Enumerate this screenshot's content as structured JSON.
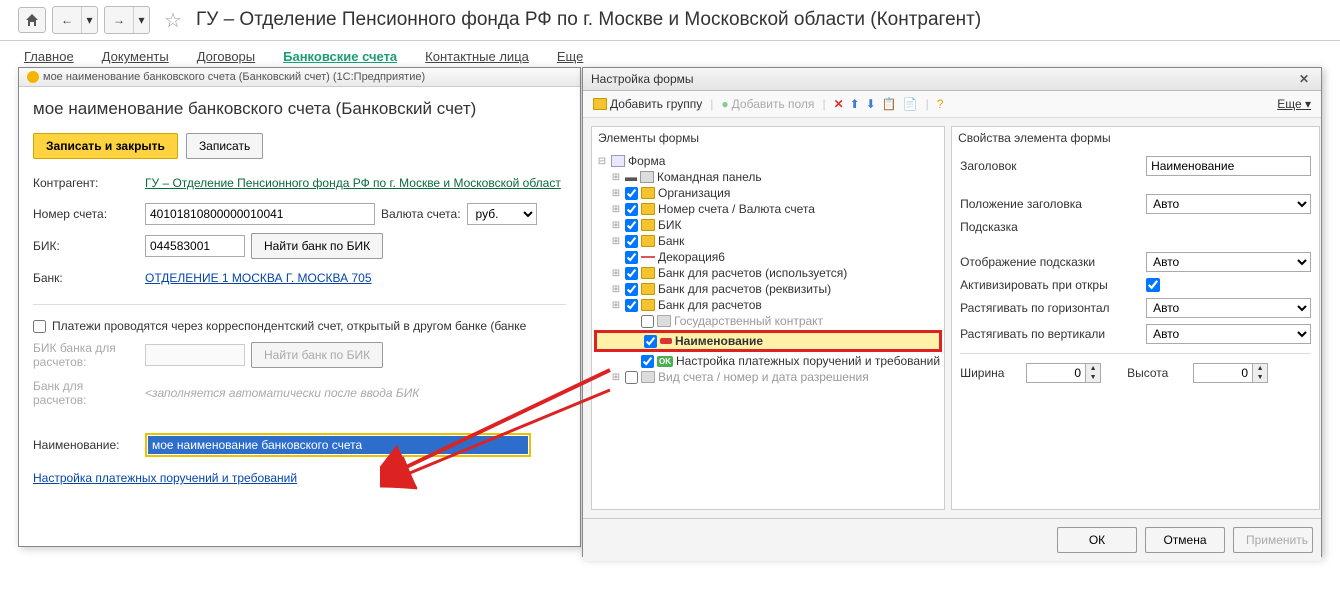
{
  "page_title": "ГУ – Отделение Пенсионного фонда РФ по г. Москве и Московской области (Контрагент)",
  "nav": {
    "tabs": [
      "Главное",
      "Документы",
      "Договоры",
      "Банковские счета",
      "Контактные лица",
      "Еще"
    ],
    "active_index": 3
  },
  "left_dialog": {
    "window_title": "мое наименование банковского счета (Банковский счет)   (1С:Предприятие)",
    "heading": "мое наименование банковского счета (Банковский счет)",
    "btn_save_close": "Записать и закрыть",
    "btn_save": "Записать",
    "counterparty_label": "Контрагент:",
    "counterparty_value": "ГУ – Отделение Пенсионного фонда РФ по г. Москве и Московской област",
    "account_label": "Номер счета:",
    "account_value": "40101810800000010041",
    "currency_label": "Валюта счета:",
    "currency_value": "руб.",
    "bik_label": "БИК:",
    "bik_value": "044583001",
    "find_bank_btn": "Найти банк по БИК",
    "bank_label": "Банк:",
    "bank_value": "ОТДЕЛЕНИЕ 1 МОСКВА Г. МОСКВА 705",
    "corr_checkbox_label": "Платежи проводятся через корреспондентский счет, открытый в другом банке (банке",
    "bik_corr_label": "БИК банка для расчетов:",
    "find_bank_btn2": "Найти банк по БИК",
    "bank_corr_label": "Банк для расчетов:",
    "bank_corr_placeholder": "<заполняется автоматически после ввода БИК",
    "name_label": "Наименование:",
    "name_value": "мое наименование банковского счета",
    "payment_settings_link": "Настройка платежных поручений и требований"
  },
  "right_dialog": {
    "title": "Настройка формы",
    "add_group": "Добавить группу",
    "add_fields": "Добавить поля",
    "more": "Еще",
    "left_panel_title": "Элементы формы",
    "right_panel_title": "Свойства элемента формы",
    "tree": {
      "root": "Форма",
      "items": [
        "Командная панель",
        "Организация",
        "Номер счета / Валюта счета",
        "БИК",
        "Банк",
        "Декорация6",
        "Банк для расчетов (используется)",
        "Банк для расчетов (реквизиты)",
        "Банк для расчетов",
        "Государственный контракт",
        "Наименование",
        "Настройка платежных поручений и требований",
        "Вид счета / номер и дата разрешения"
      ]
    },
    "props": {
      "title_label": "Заголовок",
      "title_value": "Наименование",
      "title_pos_label": "Положение заголовка",
      "title_pos_value": "Авто",
      "hint_label": "Подсказка",
      "hint_display_label": "Отображение подсказки",
      "hint_display_value": "Авто",
      "activate_label": "Активизировать при откры",
      "stretch_h_label": "Растягивать по горизонтал",
      "stretch_h_value": "Авто",
      "stretch_v_label": "Растягивать по вертикали",
      "stretch_v_value": "Авто",
      "width_label": "Ширина",
      "width_value": "0",
      "height_label": "Высота",
      "height_value": "0"
    },
    "btn_ok": "ОК",
    "btn_cancel": "Отмена",
    "btn_apply": "Применить"
  }
}
